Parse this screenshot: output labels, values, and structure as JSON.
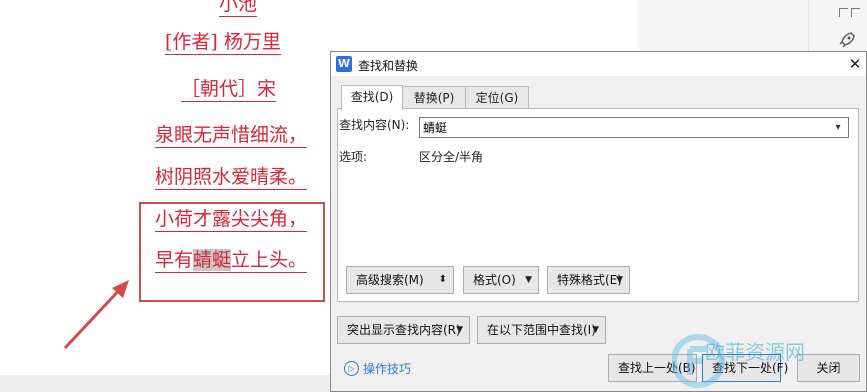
{
  "document": {
    "poem": {
      "title": "小池",
      "author_line": "[作者]  杨万里",
      "dynasty_line": "［朝代］宋",
      "line1": "泉眼无声惜细流，",
      "line2": "树阴照水爱晴柔。",
      "line3": "小荷才露尖尖角，",
      "line4_before": "早有",
      "line4_highlight": "蜻蜓",
      "line4_after": "立上头。"
    }
  },
  "dialog": {
    "app_icon_letter": "W",
    "title": "查找和替换",
    "tabs": [
      "查找(D)",
      "替换(P)",
      "定位(G)"
    ],
    "find_label": "查找内容(N):",
    "find_value": "蜻蜓",
    "options_label": "选项:",
    "options_value": "区分全/半角",
    "buttons": {
      "advanced_search": "高级搜索(M)",
      "format": "格式(O)",
      "special_format": "特殊格式(E)",
      "highlight_found": "突出显示查找内容(R)",
      "find_in_range": "在以下范围中查找(I)",
      "find_prev": "查找上一处(B)",
      "find_next": "查找下一处(F)",
      "close": "关闭"
    },
    "tips": "操作技巧"
  },
  "watermark": {
    "text": "欧菲资源网"
  },
  "colors": {
    "poem_red": "#d9263a",
    "annotation_red": "#d24b4b",
    "accent_blue": "#2f7ad8"
  }
}
